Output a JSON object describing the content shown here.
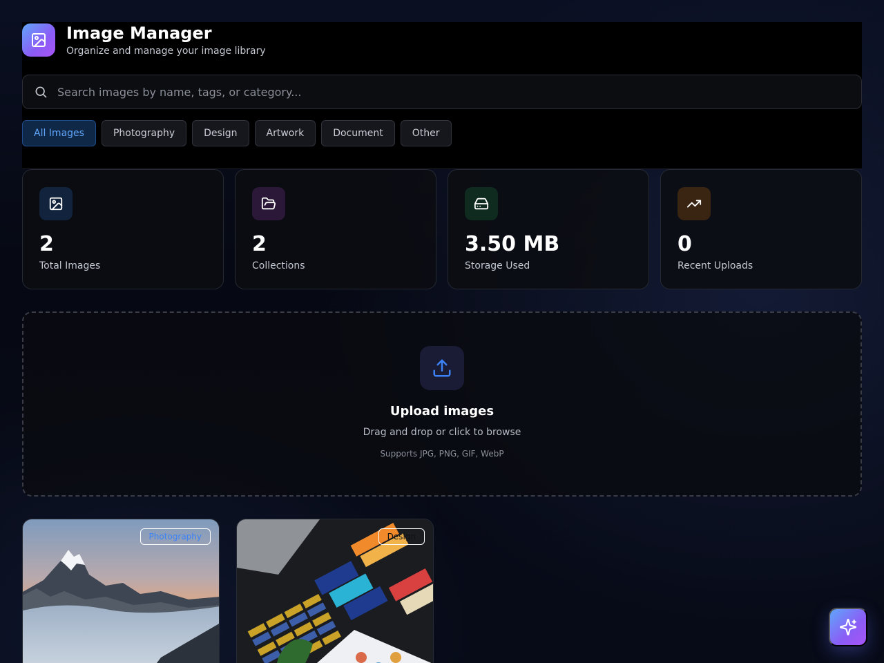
{
  "app": {
    "title": "Image Manager",
    "subtitle": "Organize and manage your image library",
    "logo_icon": "image-icon"
  },
  "search": {
    "placeholder": "Search images by name, tags, or category...",
    "value": "",
    "icon": "search-icon"
  },
  "filters": [
    {
      "label": "All Images",
      "active": true
    },
    {
      "label": "Photography",
      "active": false
    },
    {
      "label": "Design",
      "active": false
    },
    {
      "label": "Artwork",
      "active": false
    },
    {
      "label": "Document",
      "active": false
    },
    {
      "label": "Other",
      "active": false
    }
  ],
  "stats": [
    {
      "value": "2",
      "label": "Total Images",
      "icon": "image-icon",
      "color": "#60a5fa"
    },
    {
      "value": "2",
      "label": "Collections",
      "icon": "folder-open-icon",
      "color": "#c084fc"
    },
    {
      "value": "3.50 MB",
      "label": "Storage Used",
      "icon": "hard-drive-icon",
      "color": "#4ade80"
    },
    {
      "value": "0",
      "label": "Recent Uploads",
      "icon": "trending-up-icon",
      "color": "#fb923c"
    }
  ],
  "upload": {
    "title": "Upload images",
    "subtitle": "Drag and drop or click to browse",
    "hint": "Supports JPG, PNG, GIF, WebP",
    "icon": "upload-icon"
  },
  "images": [
    {
      "category": "Photography",
      "badge_color": "#3b82f6"
    },
    {
      "category": "Design",
      "badge_color": "#111111"
    }
  ],
  "fab": {
    "icon": "sparkles-icon"
  },
  "colors": {
    "accent": "#60a5fa",
    "brand_gradient_start": "#60a5fa",
    "brand_gradient_end": "#a855f7"
  }
}
